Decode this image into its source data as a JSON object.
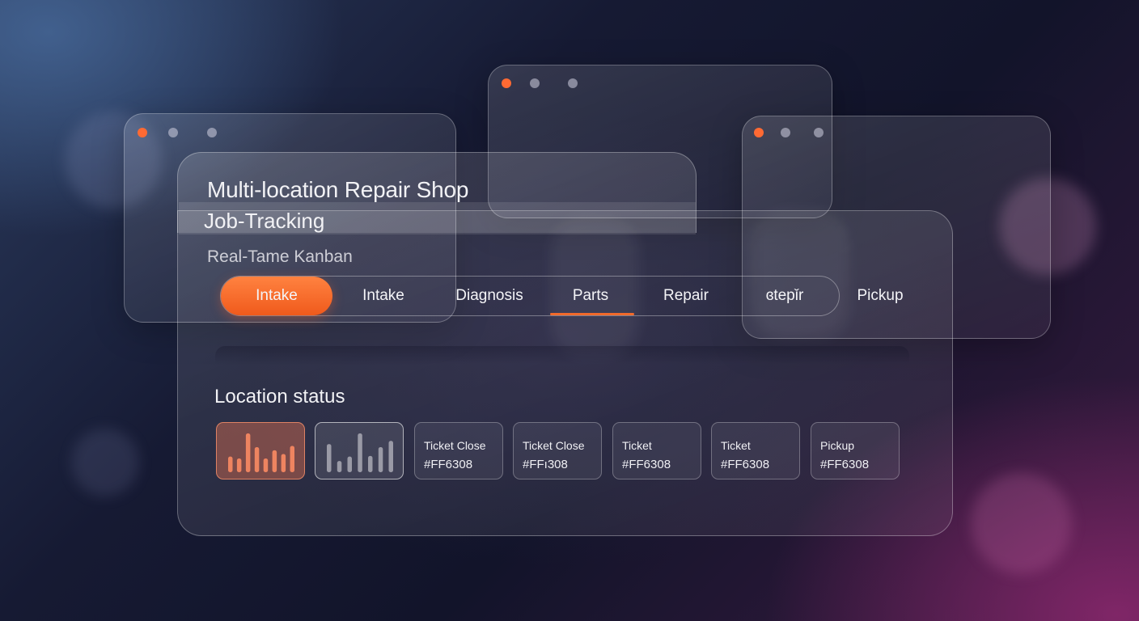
{
  "header": {
    "title": "Multi-location Repair Shop",
    "subtitle": "Job-Tracking",
    "caption": "Real-Tame Kanban"
  },
  "tabs": [
    {
      "label": "Intake",
      "active": true
    },
    {
      "label": "Intake"
    },
    {
      "label": "Diagnosis"
    },
    {
      "label": "Parts",
      "underlined": true
    },
    {
      "label": "Repair"
    },
    {
      "label": "ɞtepǐr"
    },
    {
      "label": "Pickup"
    }
  ],
  "location_status": {
    "title": "Location status",
    "cards": [
      {
        "kind": "chart",
        "bars": [
          0.25,
          0.22,
          0.62,
          0.4,
          0.22,
          0.35,
          0.29,
          0.42
        ]
      },
      {
        "kind": "chart",
        "bars": [
          0.45,
          0.18,
          0.25,
          0.62,
          0.26,
          0.4,
          0.5
        ]
      },
      {
        "line1": "Ticket Close",
        "line2": "#FF6308"
      },
      {
        "line1": "Ticket Close",
        "line2": "#FFı308"
      },
      {
        "line1": "Ticket",
        "line2": "#FF6308"
      },
      {
        "line1": "Ticket",
        "line2": "#FF6308"
      },
      {
        "line1": "Pickup",
        "line2": "#FF6308"
      }
    ]
  },
  "colors": {
    "accent": "#ff6a33",
    "accent_gradient_top": "#ff8240",
    "accent_gradient_bottom": "#f05a1c",
    "underline": "#f26a2b",
    "orange_bar": "#ee8460",
    "grey_bar": "#9a9aa6"
  },
  "window_controls": [
    "close-dot",
    "minimize-dot",
    "maximize-dot"
  ]
}
